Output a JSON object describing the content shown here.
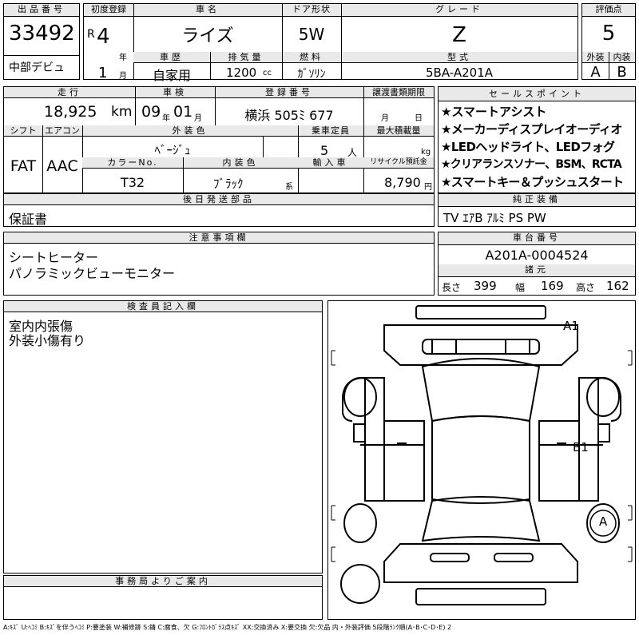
{
  "header": {
    "lot_no_label": "出品番号",
    "lot_no": "33492",
    "lot_note": "中部デビュ",
    "first_reg_label": "初度登録",
    "era": "R",
    "year": "4",
    "year_unit": "年",
    "month": "1",
    "month_unit": "月",
    "car_name_label": "車名",
    "car_name": "ライズ",
    "door_label": "ドア形状",
    "door": "5W",
    "grade_label": "グレード",
    "grade": "Z",
    "score_label": "評価点",
    "score": "5",
    "history_label": "車歴",
    "history": "自家用",
    "displacement_label": "排気量",
    "displacement": "1200",
    "displacement_unit": "cc",
    "fuel_label": "燃料",
    "fuel": "ｶﾞｿﾘﾝ",
    "model_label": "型式",
    "model": "5BA-A201A",
    "ext_label": "外装",
    "ext_grade": "A",
    "int_label": "内装",
    "int_grade": "B"
  },
  "row2": {
    "mileage_label": "走行",
    "mileage": "18,925",
    "mileage_unit": "km",
    "inspection_label": "車検",
    "insp_year": "09",
    "insp_year_unit": "年",
    "insp_month": "01",
    "insp_month_unit": "月",
    "plate_label": "登録番号",
    "plate": "横浜 505ﾐ 677",
    "transfer_label": "譲渡書類期限",
    "transfer_month_unit": "月",
    "transfer_day_unit": "日",
    "shift_label": "シフト",
    "shift": "FAT",
    "ac_label": "エアコン",
    "ac": "AAC",
    "ext_color_label": "外装色",
    "ext_color": "ﾍﾞｰｼﾞｭ",
    "capacity_label": "乗車定員",
    "capacity": "5",
    "capacity_unit": "人",
    "load_label": "最大積載量",
    "load_unit": "kg",
    "color_no_label": "カラーNo.",
    "color_no": "T32",
    "int_color_label": "内装色",
    "int_color": "ﾌﾞﾗｯｸ",
    "int_color_unit": "系",
    "import_label": "輸入車",
    "recycle_label": "リサイクル預託金",
    "recycle": "8,790",
    "recycle_unit": "円",
    "later_parts_label": "後日発送部品",
    "later_parts": "保証書"
  },
  "sales": {
    "label": "セールスポイント",
    "points": [
      "★スマートアシスト",
      "★メーカーディスプレイオーディオ",
      "★LEDヘッドライト、LEDフォグ",
      "★クリアランスソナー、BSM、RCTA",
      "★スマートキー＆プッシュスタート"
    ],
    "equip_label": "純正装備",
    "equip": "TV ｴｱB ｱﾙﾐ PS PW"
  },
  "notes": {
    "label": "注意事項欄",
    "lines": [
      "シートヒーター",
      "パノラミックビューモニター"
    ]
  },
  "chassis": {
    "label": "車台番号",
    "number": "A201A-0004524",
    "spec_label": "諸元",
    "length_label": "長さ",
    "length": "399",
    "width_label": "幅",
    "width": "169",
    "height_label": "高さ",
    "height": "162"
  },
  "inspector": {
    "label": "検査員記入欄",
    "lines": [
      "室内内張傷",
      "外装小傷有り"
    ]
  },
  "office": {
    "label": "事務局よりご案内"
  },
  "diagram": {
    "marks": [
      "A1",
      "B1",
      "A"
    ]
  },
  "footer": {
    "legend": "A:ｷｽﾞ U:ﾍｺﾐ B:ｷｽﾞを伴うﾍｺﾐ P:要塗装 W:補修跡 S:錆 C:腐食、欠 G:ﾌﾛﾝﾄｶﾞﾗｽ点ｷｽﾞ XX:交換済み X:要交換 欠:欠品 内・外装評価 5段階ﾗﾝｸ順(A･B･C･D･E) 2"
  }
}
